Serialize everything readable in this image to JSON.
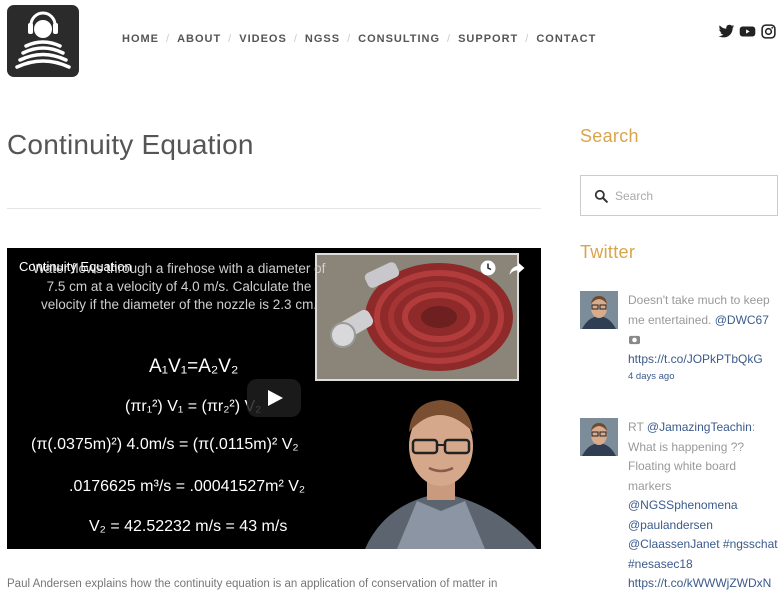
{
  "header": {
    "nav": [
      "HOME",
      "ABOUT",
      "VIDEOS",
      "NGSS",
      "CONSULTING",
      "SUPPORT",
      "CONTACT"
    ],
    "social": [
      "twitter-icon",
      "youtube-icon",
      "instagram-icon"
    ]
  },
  "main": {
    "title": "Continuity Equation",
    "video": {
      "title": "Continuity Equation",
      "problem": "Water flows through a firehose with a diameter of 7.5 cm at a velocity of 4.0 m/s. Calculate the velocity if the diameter of the nozzle is 2.3 cm.",
      "eq1": "A₁V₁=A₂V₂",
      "eq2": "(πr₁²) V₁ = (πr₂²) V₂",
      "eq3": "(π(.0375m)²) 4.0m/s = (π(.0115m)² V₂",
      "eq4": ".0176625 m³/s = .00041527m² V₂",
      "eq5": "V₂ = 42.52232 m/s = 43 m/s"
    },
    "description": "Paul Andersen explains how the continuity equation is an application of conservation of matter in"
  },
  "sidebar": {
    "search_heading": "Search",
    "search_placeholder": "Search",
    "twitter_heading": "Twitter",
    "tweets": [
      {
        "l1": "Doesn't take much to keep",
        "l2a": "me entertained. ",
        "l2b": "@DWC67",
        "url": "https://t.co/JOPkPTbQkG",
        "time": "4 days ago"
      },
      {
        "l1a": "RT ",
        "l1b": "@JamazingTeachin",
        "l1c": ":",
        "l2": "What is happening ??",
        "l3": "Floating white board",
        "l4": "markers",
        "l5": "@NGSSphenomena",
        "l6": "@paulandersen",
        "l7a": "@ClaassenJanet",
        "l7b": " #ngsschat",
        "l8": "#nesasec18",
        "url": "https://t.co/kWWWjZWDxN"
      }
    ]
  }
}
